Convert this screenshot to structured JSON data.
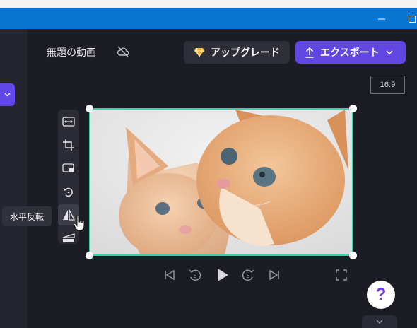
{
  "project": {
    "title": "無題の動画"
  },
  "header": {
    "upgrade_label": "アップグレード",
    "export_label": "エクスポート"
  },
  "aspect_ratio": "16:9",
  "tools": [
    {
      "name": "fit-icon"
    },
    {
      "name": "crop-icon"
    },
    {
      "name": "picture-in-picture-icon"
    },
    {
      "name": "rotate-icon"
    },
    {
      "name": "flip-horizontal-icon"
    },
    {
      "name": "flip-vertical-icon"
    }
  ],
  "tooltip": {
    "text": "水平反転"
  },
  "colors": {
    "accent": "#6146e4",
    "selection": "#31d6a6",
    "titlebar": "#0a74d1",
    "upgrade_gem": "#f5b531"
  }
}
